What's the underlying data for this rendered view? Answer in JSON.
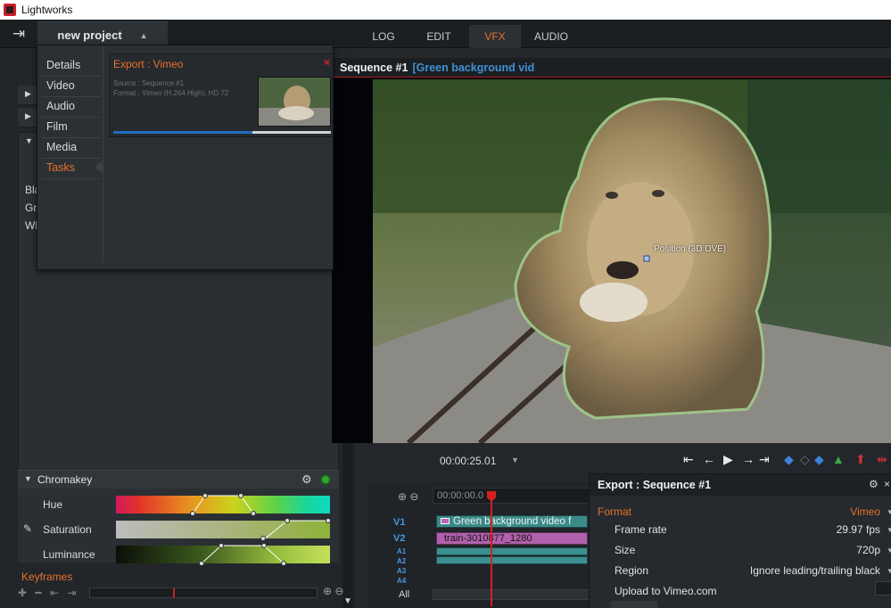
{
  "app": {
    "title": "Lightworks"
  },
  "topbar": {
    "project_name": "new project",
    "rooms": [
      "LOG",
      "EDIT",
      "VFX",
      "AUDIO"
    ],
    "active_room": "VFX"
  },
  "left_panel": {
    "section_text": [
      "Bla",
      "Gre",
      "Wh"
    ]
  },
  "popup": {
    "menu": [
      "Details",
      "Video",
      "Audio",
      "Film",
      "Media",
      "Tasks"
    ],
    "active": "Tasks",
    "task": {
      "title": "Export : Vimeo",
      "close_label": "×",
      "source_line": "Source : Sequence #1",
      "format_line": "Format : Vimeo (H.264 High), HD 72",
      "progress": 0.64
    }
  },
  "viewer": {
    "sequence": "Sequence #1",
    "clip_name": "[Green background vid",
    "effect_label": "Position (3D DVE)",
    "timecode": "00:00:25.01"
  },
  "chromakey": {
    "title": "Chromakey",
    "rows": [
      "Hue",
      "Saturation",
      "Luminance"
    ]
  },
  "keyframes": {
    "label": "Keyframes"
  },
  "timeline": {
    "ruler_tc": "00:00:00.0",
    "tracks": [
      "V1",
      "V2",
      "A1",
      "A2",
      "A3",
      "A4"
    ],
    "clip_v1": "Green background video f",
    "clip_v2": "train-3010877_1280",
    "all_label": "All"
  },
  "export_panel": {
    "title": "Export : Sequence #1",
    "format_label": "Format",
    "format_value": "Vimeo",
    "settings": [
      {
        "label": "Frame rate",
        "value": "29.97 fps"
      },
      {
        "label": "Size",
        "value": "720p"
      },
      {
        "label": "Region",
        "value": "Ignore leading/trailing black"
      }
    ],
    "upload_label": "Upload to Vimeo.com"
  },
  "colors": {
    "accent_orange": "#e8702a",
    "accent_blue": "#3f8fd6",
    "red": "#d42020",
    "panel_bg": "#24282c"
  }
}
